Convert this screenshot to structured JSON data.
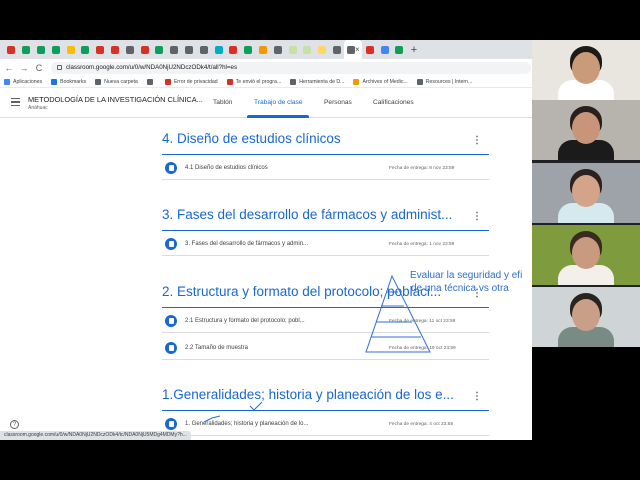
{
  "browser": {
    "tab_favicon_colors": [
      "#d93025",
      "#0f9d58",
      "#0f9d58",
      "#0f9d58",
      "#fbbc04",
      "#0f9d58",
      "#d93025",
      "#d93025",
      "#5f6368",
      "#d93025",
      "#0f9d58",
      "#5f6368",
      "#5f6368",
      "#5f6368",
      "#00acc1",
      "#d93025",
      "#0f9d58",
      "#f29900",
      "#5f6368",
      "#c5e1a5",
      "#c5e1a5",
      "#fdd663",
      "#5f6368",
      "#5f6368",
      "#d93025",
      "#4285f4",
      "#0f9d58"
    ],
    "tab_close": "×",
    "new_tab": "+",
    "url": "classroom.google.com/u/0/w/NDA0NjU2NDczODk4/t/all?hl=es",
    "back": "←",
    "forward": "→",
    "reload": "C",
    "bookmarks": [
      {
        "label": "Aplicaciones",
        "icon": "apps-grid-icon",
        "color": "#4285f4"
      },
      {
        "label": "Bookmarks",
        "icon": "star-icon",
        "color": "#1a73e8"
      },
      {
        "label": "Nueva carpeta",
        "icon": "folder-icon",
        "color": "#5f6368"
      },
      {
        "label": "",
        "icon": "gear-icon",
        "color": "#5f6368"
      },
      {
        "label": "Error de privacidad",
        "icon": "warning-icon",
        "color": "#d93025"
      },
      {
        "label": "Te envió el progra...",
        "icon": "gmail-icon",
        "color": "#d93025"
      },
      {
        "label": "Herramienta de D...",
        "icon": "globe-icon",
        "color": "#5f6368"
      },
      {
        "label": "Archives of Medic...",
        "icon": "document-icon",
        "color": "#f29900"
      },
      {
        "label": "Resources | Intern...",
        "icon": "globe-icon",
        "color": "#5f6368"
      }
    ]
  },
  "classroom": {
    "title": "METODOLOGÍA DE LA INVESTIGACIÓN CLÍNICA...",
    "subtitle": "Anáhuac",
    "tabs": [
      {
        "label": "Tablón",
        "active": false
      },
      {
        "label": "Trabajo de clase",
        "active": true
      },
      {
        "label": "Personas",
        "active": false
      },
      {
        "label": "Calificaciones",
        "active": false
      }
    ],
    "topics": [
      {
        "title": "4. Diseño de estudios clínicos",
        "items": [
          {
            "title": "4.1 Diseño de estudios clínicos",
            "due": "Fecha de entrega: 8 nov 23:59"
          }
        ]
      },
      {
        "title": "3. Fases del desarrollo de fármacos y administ...",
        "items": [
          {
            "title": "3. Fases del desarrollo de fármacos y admin...",
            "due": "Fecha de entrega: 1 nov 23:59"
          }
        ]
      },
      {
        "title": "2. Estructura y formato del protocolo; poblaci...",
        "items": [
          {
            "title": "2.1 Estructura y formato del protocolo; pobl...",
            "due": "Fecha de entrega: 11 oct 23:59"
          },
          {
            "title": "2.2 Tamaño de muestra",
            "due": "Fecha de entrega: 19 oct 23:59"
          }
        ]
      },
      {
        "title": "1.Generalidades; historia y planeación de los e...",
        "items": [
          {
            "title": "1. Generalidades; historia y planeación de lo...",
            "due": "Fecha de entrega: 4 oct 23:59"
          }
        ]
      }
    ],
    "help": "?",
    "status_url": "classroom.google.com/u/0/w/NDA0NjU2NDczODk4/tc/NDA0NjU5MDg4MDMy?h..."
  },
  "annotation": {
    "line1": "Evaluar la seguridad y efi",
    "line2": "de una técnica vs otra",
    "color": "#2e6fd1"
  },
  "participants": [
    {
      "name": "participant-1",
      "bg": "#e9e5df",
      "skin": "#c99b7a",
      "hair": "#1d1a18",
      "shirt": "#ffffff"
    },
    {
      "name": "participant-2",
      "bg": "#b7b3ad",
      "skin": "#c8957a",
      "hair": "#2a1f1a",
      "shirt": "#1b1b1b"
    },
    {
      "name": "participant-3",
      "bg": "#9da3a8",
      "skin": "#d4a48a",
      "hair": "#2b2220",
      "shirt": "#d6e9ee"
    },
    {
      "name": "participant-4",
      "bg": "#7e9b3d",
      "skin": "#c99a80",
      "hair": "#3a2b22",
      "shirt": "#f3f0ec"
    },
    {
      "name": "participant-5",
      "bg": "#cfd4d6",
      "skin": "#c9a087",
      "hair": "#2a241f",
      "shirt": "#7a8b85"
    }
  ]
}
